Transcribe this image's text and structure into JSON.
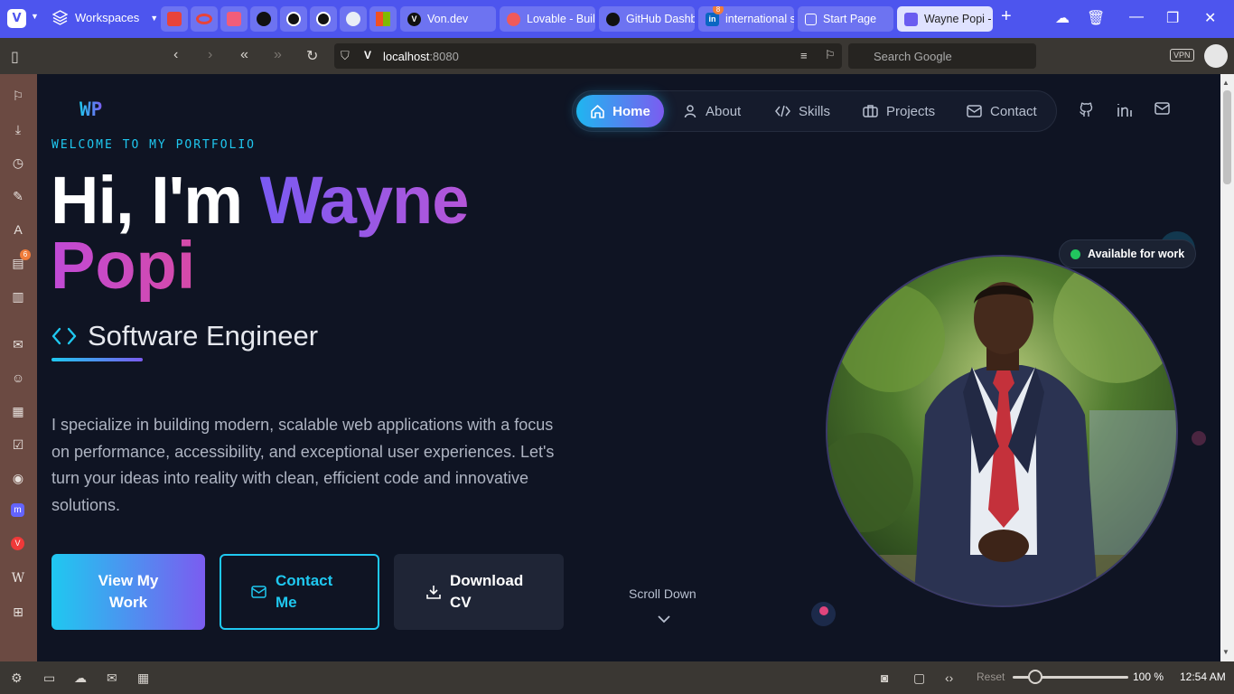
{
  "browser": {
    "workspaces_label": "Workspaces",
    "tabs": [
      {
        "label": "Von.dev"
      },
      {
        "label": "Lovable - Build"
      },
      {
        "label": "GitHub Dashb"
      },
      {
        "label": "international s",
        "badge": "8"
      },
      {
        "label": "Start Page"
      },
      {
        "label": "Wayne Popi -",
        "active": true
      }
    ],
    "url_host": "localhost",
    "url_port": ":8080",
    "search_placeholder": "Search Google",
    "vpn_label": "VPN",
    "sidebar_badge": "6",
    "status": {
      "reset_label": "Reset",
      "zoom": "100 %",
      "clock": "12:54 AM"
    }
  },
  "site": {
    "logo": "WP",
    "nav": [
      "Home",
      "About",
      "Skills",
      "Projects",
      "Contact"
    ],
    "welcome": "WELCOME TO MY PORTFOLIO",
    "hero_prefix": "Hi, I'm ",
    "hero_first": "Wayne",
    "hero_last": "Popi",
    "role": "Software Engineer",
    "description": "I specialize in building modern, scalable web applications with a focus on performance, accessibility, and exceptional user experiences. Let's turn your ideas into reality with clean, efficient code and innovative solutions.",
    "buttons": {
      "view_work": "View My Work",
      "contact": "Contact Me",
      "download": "Download CV"
    },
    "scroll_down": "Scroll Down",
    "available": "Available for work"
  }
}
